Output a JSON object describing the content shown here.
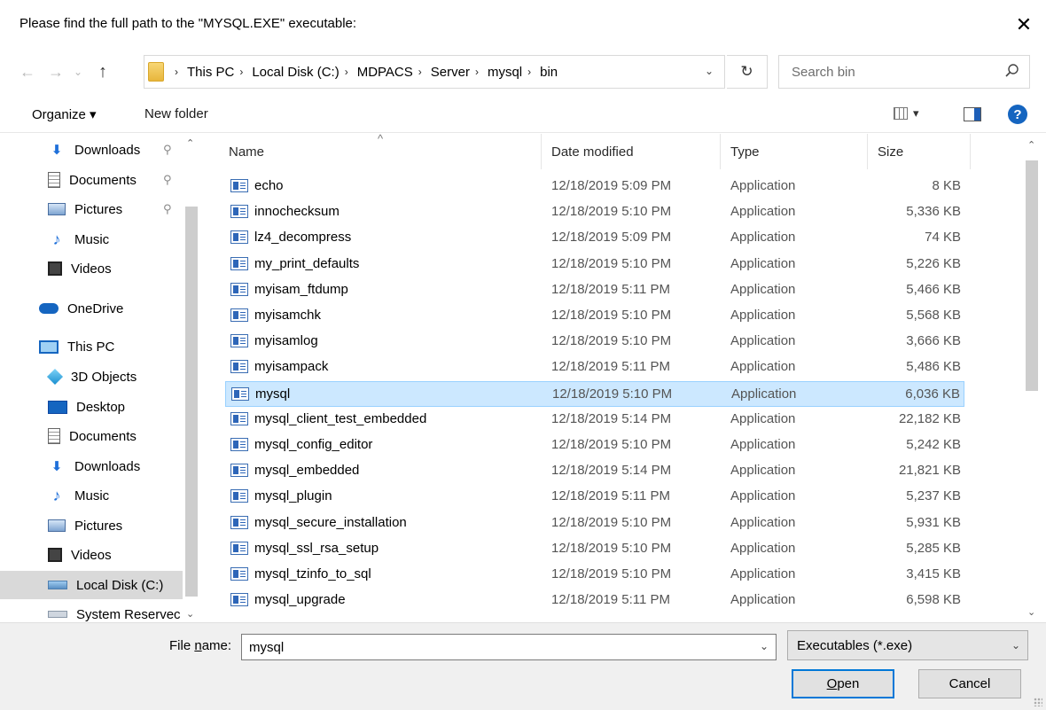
{
  "window": {
    "title": "Please find the full path to the \"MYSQL.EXE\" executable:",
    "close_glyph": "✕"
  },
  "address": {
    "breadcrumbs": [
      "This PC",
      "Local Disk (C:)",
      "MDPACS",
      "Server",
      "mysql",
      "bin"
    ],
    "search_placeholder": "Search bin"
  },
  "toolbar": {
    "organize_label": "Organize ▾",
    "new_folder_label": "New folder",
    "view_dropdown": "▾",
    "help_label": "?"
  },
  "nav": {
    "items": [
      {
        "label": "Downloads",
        "icon": "download-arrow-icon",
        "pinned": true
      },
      {
        "label": "Documents",
        "icon": "document-icon",
        "pinned": true
      },
      {
        "label": "Pictures",
        "icon": "pictures-icon",
        "pinned": true
      },
      {
        "label": "Music",
        "icon": "music-icon",
        "pinned": false
      },
      {
        "label": "Videos",
        "icon": "videos-icon",
        "pinned": false
      },
      {
        "label": "OneDrive",
        "icon": "cloud-icon",
        "pinned": false
      },
      {
        "label": "This PC",
        "icon": "computer-icon",
        "pinned": false
      },
      {
        "label": "3D Objects",
        "icon": "cube-icon",
        "pinned": false
      },
      {
        "label": "Desktop",
        "icon": "desktop-icon",
        "pinned": false
      },
      {
        "label": "Documents",
        "icon": "document-icon",
        "pinned": false
      },
      {
        "label": "Downloads",
        "icon": "download-arrow-icon",
        "pinned": false
      },
      {
        "label": "Music",
        "icon": "music-icon",
        "pinned": false
      },
      {
        "label": "Pictures",
        "icon": "pictures-icon",
        "pinned": false
      },
      {
        "label": "Videos",
        "icon": "videos-icon",
        "pinned": false
      },
      {
        "label": "Local Disk (C:)",
        "icon": "disk-icon",
        "pinned": false,
        "selected": true
      },
      {
        "label": "System Reservec",
        "icon": "disk-icon",
        "pinned": false
      }
    ]
  },
  "files": {
    "columns": {
      "name": "Name",
      "date": "Date modified",
      "type": "Type",
      "size": "Size"
    },
    "rows": [
      {
        "name": "echo",
        "date": "12/18/2019 5:09 PM",
        "type": "Application",
        "size": "8 KB"
      },
      {
        "name": "innochecksum",
        "date": "12/18/2019 5:10 PM",
        "type": "Application",
        "size": "5,336 KB"
      },
      {
        "name": "lz4_decompress",
        "date": "12/18/2019 5:09 PM",
        "type": "Application",
        "size": "74 KB"
      },
      {
        "name": "my_print_defaults",
        "date": "12/18/2019 5:10 PM",
        "type": "Application",
        "size": "5,226 KB"
      },
      {
        "name": "myisam_ftdump",
        "date": "12/18/2019 5:11 PM",
        "type": "Application",
        "size": "5,466 KB"
      },
      {
        "name": "myisamchk",
        "date": "12/18/2019 5:10 PM",
        "type": "Application",
        "size": "5,568 KB"
      },
      {
        "name": "myisamlog",
        "date": "12/18/2019 5:10 PM",
        "type": "Application",
        "size": "3,666 KB"
      },
      {
        "name": "myisampack",
        "date": "12/18/2019 5:11 PM",
        "type": "Application",
        "size": "5,486 KB"
      },
      {
        "name": "mysql",
        "date": "12/18/2019 5:10 PM",
        "type": "Application",
        "size": "6,036 KB",
        "selected": true
      },
      {
        "name": "mysql_client_test_embedded",
        "date": "12/18/2019 5:14 PM",
        "type": "Application",
        "size": "22,182 KB"
      },
      {
        "name": "mysql_config_editor",
        "date": "12/18/2019 5:10 PM",
        "type": "Application",
        "size": "5,242 KB"
      },
      {
        "name": "mysql_embedded",
        "date": "12/18/2019 5:14 PM",
        "type": "Application",
        "size": "21,821 KB"
      },
      {
        "name": "mysql_plugin",
        "date": "12/18/2019 5:11 PM",
        "type": "Application",
        "size": "5,237 KB"
      },
      {
        "name": "mysql_secure_installation",
        "date": "12/18/2019 5:10 PM",
        "type": "Application",
        "size": "5,931 KB"
      },
      {
        "name": "mysql_ssl_rsa_setup",
        "date": "12/18/2019 5:10 PM",
        "type": "Application",
        "size": "5,285 KB"
      },
      {
        "name": "mysql_tzinfo_to_sql",
        "date": "12/18/2019 5:10 PM",
        "type": "Application",
        "size": "3,415 KB"
      },
      {
        "name": "mysql_upgrade",
        "date": "12/18/2019 5:11 PM",
        "type": "Application",
        "size": "6,598 KB"
      }
    ]
  },
  "bottom": {
    "file_name_label_pre": "File ",
    "file_name_label_u": "n",
    "file_name_label_post": "ame:",
    "file_name_value": "mysql",
    "filter_value": "Executables (*.exe)",
    "open_u": "O",
    "open_rest": "pen",
    "cancel_label": "Cancel"
  },
  "colors": {
    "accent": "#0078d7",
    "selection_bg": "#cce8ff",
    "selection_border": "#99d1ff",
    "nav_selected": "#d9d9d9"
  }
}
